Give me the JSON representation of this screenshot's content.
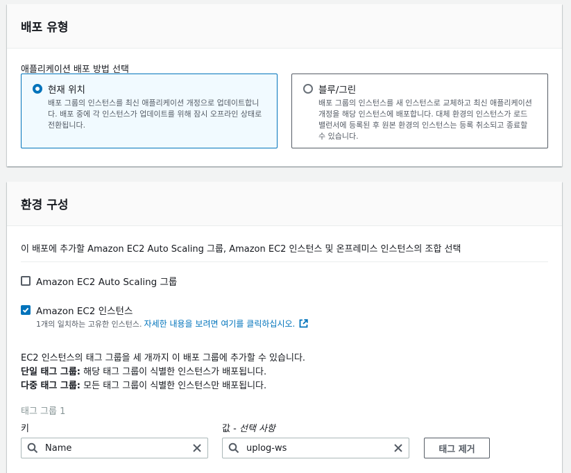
{
  "deployment_type": {
    "title": "배포 유형",
    "prompt": "애플리케이션 배포 방법 선택",
    "options": [
      {
        "label": "현재 위치",
        "description": "배포 그룹의 인스턴스를 최신 애플리케이션 개정으로 업데이트합니다. 배포 중에 각 인스턴스가 업데이트를 위해 잠시 오프라인 상태로 전환됩니다.",
        "selected": true
      },
      {
        "label": "블루/그린",
        "description": "배포 그룹의 인스턴스를 새 인스턴스로 교체하고 최신 애플리케이션 개정을 해당 인스턴스에 배포합니다. 대체 환경의 인스턴스가 로드 밸런서에 등록된 후 원본 환경의 인스턴스는 등록 취소되고 종료할 수 있습니다.",
        "selected": false
      }
    ]
  },
  "environment": {
    "title": "환경 구성",
    "description": "이 배포에 추가할 Amazon EC2 Auto Scaling 그룹, Amazon EC2 인스턴스 및 온프레미스 인스턴스의 조합 선택",
    "checkboxes": [
      {
        "label": "Amazon EC2 Auto Scaling 그룹",
        "checked": false
      },
      {
        "label": "Amazon EC2 인스턴스",
        "checked": true
      }
    ],
    "match_note": "1개의 일치하는 고유한 인스턴스.",
    "match_link": "자세한 내용을 보려면 여기를 클릭하십시오.",
    "info_line1": "EC2 인스턴스의 태그 그룹을 세 개까지 이 배포 그룹에 추가할 수 있습니다.",
    "single_tag_bold": "단일 태그 그룹:",
    "single_tag_text": " 해당 태그 그룹이 식별한 인스턴스가 배포됩니다.",
    "multi_tag_bold": "다중 태그 그룹:",
    "multi_tag_text": " 모든 태그 그룹이 식별한 인스턴스만 배포됩니다.",
    "tag_group_label": "태그 그룹 1",
    "key_label": "키",
    "value_label_main": "값 - ",
    "value_label_optional": "선택 사항",
    "key_value": "Name",
    "value_value": "uplog-ws",
    "remove_tag_button": "태그 제거"
  },
  "colors": {
    "accent": "#0073bb",
    "selected_bg": "#f1faff",
    "text": "#16191f",
    "muted": "#545b64"
  }
}
